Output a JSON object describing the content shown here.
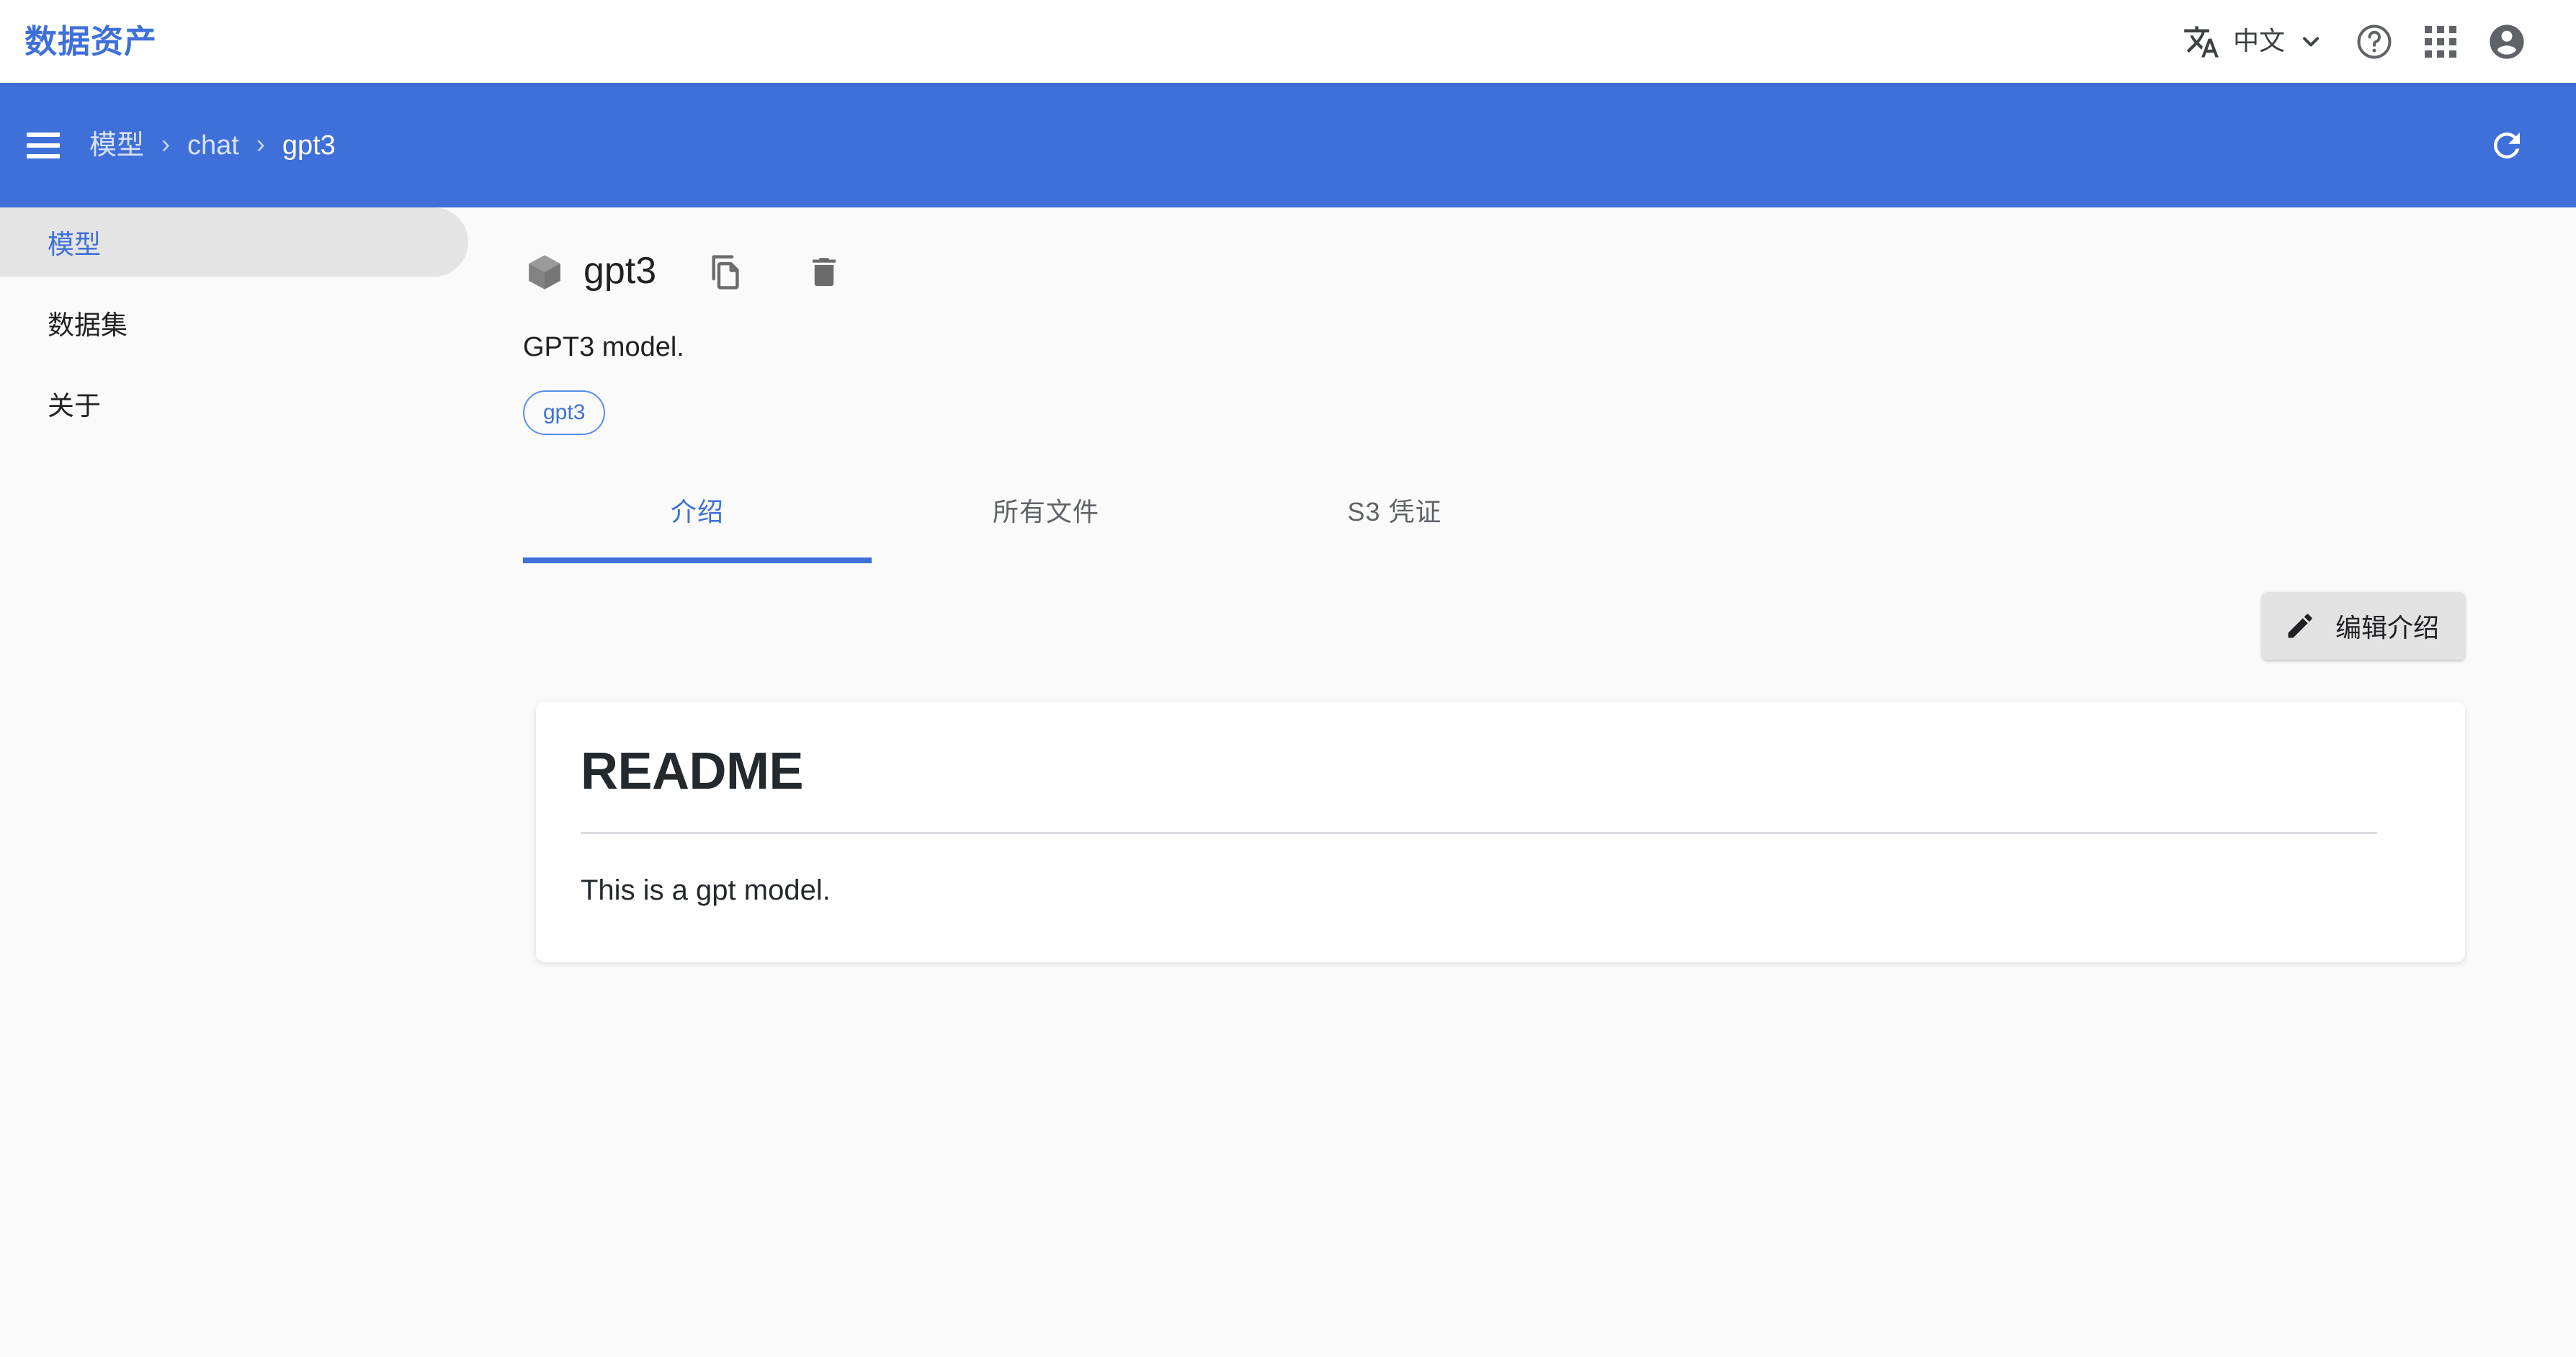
{
  "topbar": {
    "app_title": "数据资产",
    "language": {
      "icon": "translate-icon",
      "label": "中文",
      "chevron": "chevron-down-icon"
    },
    "help_icon": "help-circle-icon",
    "apps_icon": "apps-grid-icon",
    "account_icon": "account-circle-icon"
  },
  "breadcrumb_bar": {
    "menu_icon": "hamburger-menu-icon",
    "items": [
      {
        "label": "模型"
      },
      {
        "label": "chat"
      },
      {
        "label": "gpt3"
      }
    ],
    "separator": "›",
    "refresh_icon": "refresh-icon"
  },
  "sidebar": {
    "items": [
      {
        "label": "模型",
        "active": true
      },
      {
        "label": "数据集",
        "active": false
      },
      {
        "label": "关于",
        "active": false
      }
    ]
  },
  "main": {
    "model": {
      "icon": "cube-icon",
      "name": "gpt3",
      "copy_icon": "copy-icon",
      "delete_icon": "trash-icon",
      "description": "GPT3 model.",
      "tags": [
        "gpt3"
      ]
    },
    "tabs": [
      {
        "label": "介绍",
        "active": true
      },
      {
        "label": "所有文件",
        "active": false
      },
      {
        "label": "S3 凭证",
        "active": false
      }
    ],
    "edit_button": {
      "icon": "pencil-icon",
      "label": "编辑介绍"
    },
    "readme": {
      "title": "README",
      "body": "This is a gpt model."
    }
  },
  "colors": {
    "brand_blue": "#3f6fd8",
    "page_bg": "#fafafa",
    "card_bg": "#ffffff",
    "sidebar_active_bg": "#e4e4e4",
    "text_primary": "#202124",
    "text_secondary": "#5f6368",
    "divider": "#d8dbdf",
    "button_bg": "#e2e2e2"
  }
}
